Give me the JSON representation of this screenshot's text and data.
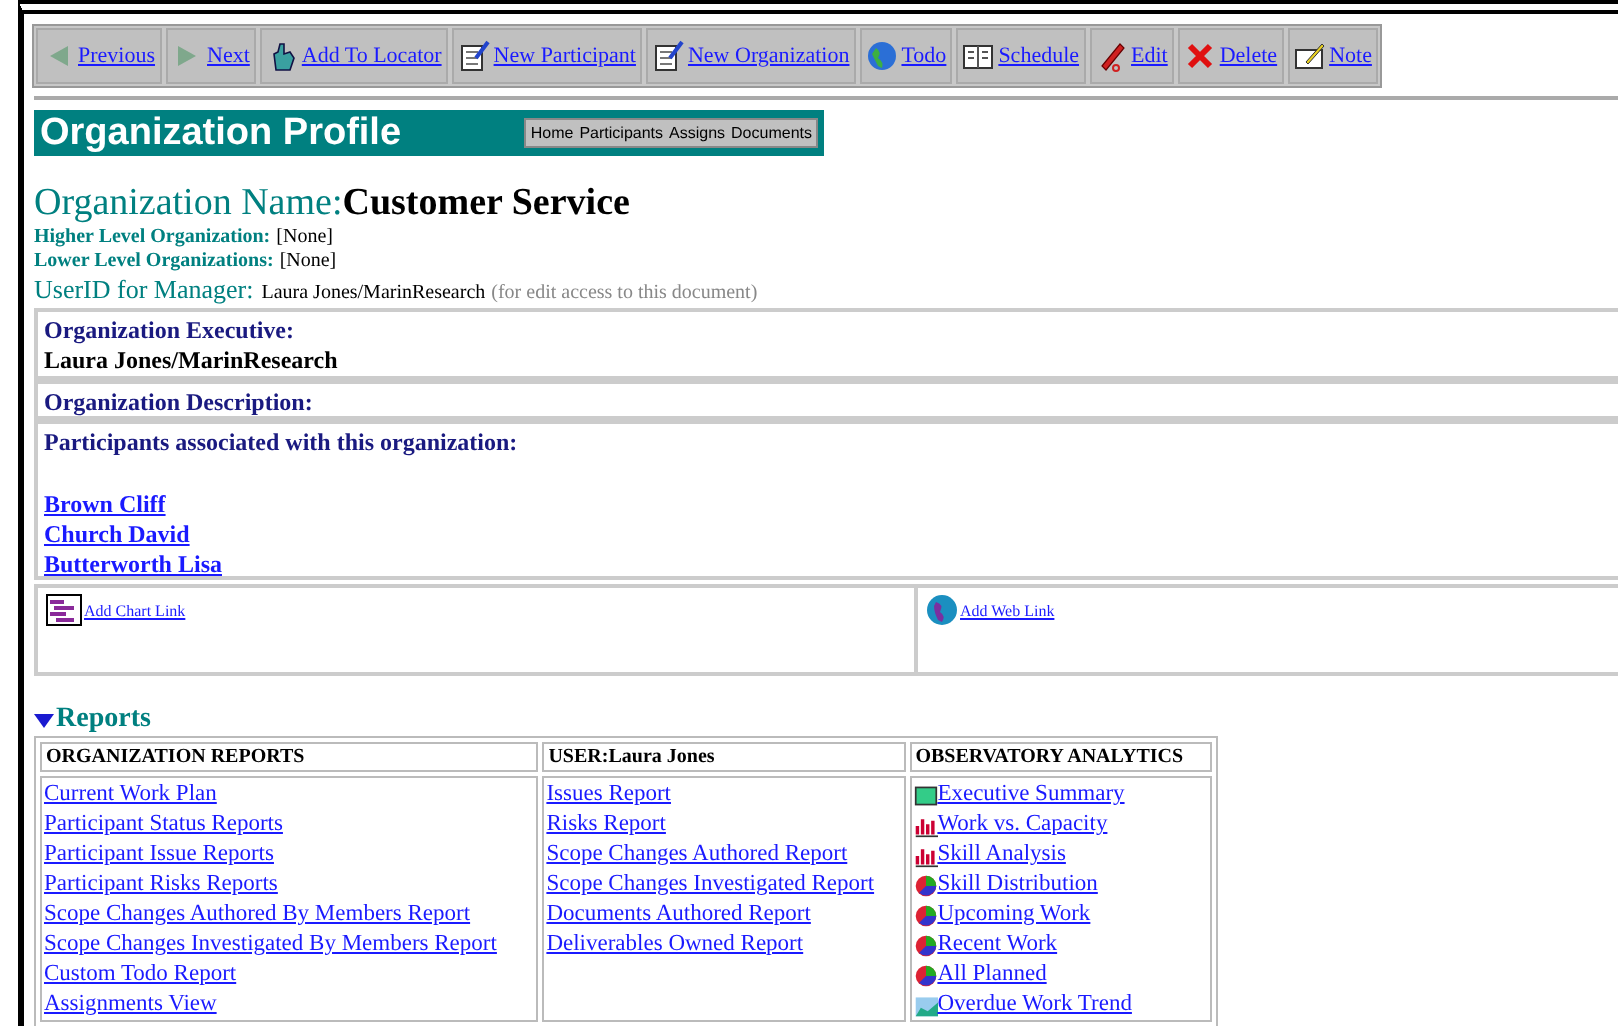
{
  "toolbar": [
    {
      "label": "Previous",
      "kind": "back"
    },
    {
      "label": "Next",
      "kind": "forward"
    },
    {
      "label": "Add To Locator",
      "kind": "hand"
    },
    {
      "label": "New Participant",
      "kind": "notepad"
    },
    {
      "label": "New Organization",
      "kind": "notepad"
    },
    {
      "label": "Todo",
      "kind": "globe"
    },
    {
      "label": "Schedule",
      "kind": "book"
    },
    {
      "label": "Edit",
      "kind": "pen"
    },
    {
      "label": "Delete",
      "kind": "cross"
    },
    {
      "label": "Note",
      "kind": "note"
    }
  ],
  "banner": {
    "title": "Organization Profile",
    "nav": [
      "Home",
      "Participants",
      "Assigns",
      "Documents"
    ]
  },
  "organization": {
    "name_label": "Organization Name:",
    "name": "Customer Service",
    "fields": [
      {
        "label": "Higher Level Organization:",
        "value": "[None]"
      },
      {
        "label": "Lower Level Organizations:",
        "value": "[None]"
      }
    ],
    "manager_label": "UserID for Manager:",
    "manager": "Laura Jones/MarinResearch",
    "manager_note": "(for edit access to this document)"
  },
  "executive": {
    "label": "Organization Executive:",
    "value": "Laura Jones/MarinResearch"
  },
  "description": {
    "label": "Organization Description:"
  },
  "participants": {
    "label": "Participants associated with this organization:",
    "items": [
      "Brown Cliff",
      "Church David",
      "Butterworth Lisa"
    ]
  },
  "links": [
    {
      "label": "Add Chart Link",
      "kind": "chart"
    },
    {
      "label": "Add Web Link",
      "kind": "web"
    }
  ],
  "reports": {
    "title": "Reports",
    "expanded": true,
    "columns": [
      {
        "heading": "ORGANIZATION REPORTS",
        "items": [
          {
            "label": "Current Work Plan"
          },
          {
            "label": "Participant Status Reports"
          },
          {
            "label": "Participant Issue Reports"
          },
          {
            "label": "Participant Risks Reports"
          },
          {
            "label": "Scope Changes Authored By Members Report"
          },
          {
            "label": "Scope Changes Investigated By Members Report"
          },
          {
            "label": "Custom Todo Report"
          },
          {
            "label": "Assignments View"
          }
        ]
      },
      {
        "heading": "USER:Laura Jones",
        "items": [
          {
            "label": "Issues Report"
          },
          {
            "label": "Risks Report"
          },
          {
            "label": "Scope Changes Authored Report"
          },
          {
            "label": "Scope Changes Investigated Report"
          },
          {
            "label": "Documents Authored Report"
          },
          {
            "label": "Deliverables Owned Report"
          }
        ]
      },
      {
        "heading": "OBSERVATORY ANALYTICS",
        "items": [
          {
            "label": "Executive Summary",
            "kind": "summary"
          },
          {
            "label": "Work vs. Capacity",
            "kind": "bars"
          },
          {
            "label": "Skill Analysis",
            "kind": "bars"
          },
          {
            "label": "Skill Distribution",
            "kind": "pie"
          },
          {
            "label": "Upcoming Work",
            "kind": "pie"
          },
          {
            "label": "Recent Work",
            "kind": "pie"
          },
          {
            "label": "All Planned",
            "kind": "pie"
          },
          {
            "label": "Overdue Work Trend",
            "kind": "area"
          }
        ]
      }
    ]
  }
}
